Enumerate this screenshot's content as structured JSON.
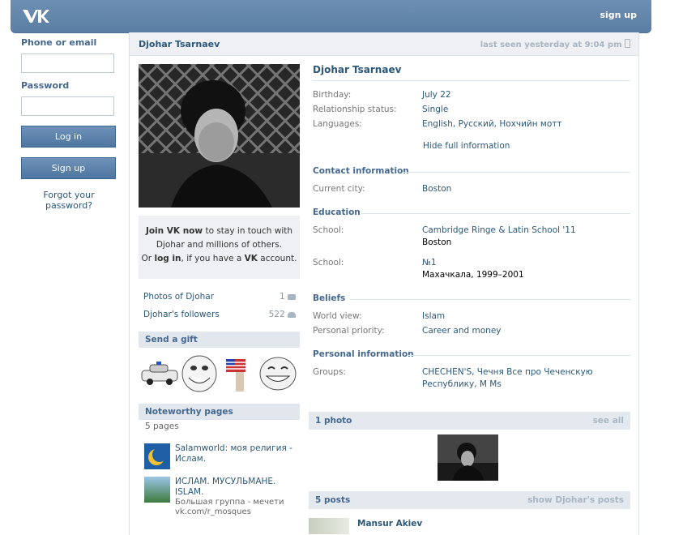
{
  "header": {
    "logo_text": "VK",
    "signup_label": "sign up"
  },
  "login": {
    "phone_label": "Phone or email",
    "password_label": "Password",
    "login_button": "Log in",
    "signup_button": "Sign up",
    "forgot_label": "Forgot your password?"
  },
  "profile": {
    "name": "Djohar Tsarnaev",
    "last_seen": "last seen yesterday at 9:04 pm",
    "join_box": {
      "part1": "Join VK now",
      "part2": " to stay in touch with",
      "line2": "Djohar and millions of others.",
      "line3a": "Or ",
      "line3b": "log in",
      "line3c": ", if you have a ",
      "line3d": "VK",
      "line3e": " account."
    },
    "photos_link": {
      "label": "Photos of Djohar",
      "count": "1"
    },
    "followers_link": {
      "label": "Djohar's followers",
      "count": "522"
    },
    "gift_header": "Send a gift",
    "noteworthy": {
      "header": "Noteworthy pages",
      "count": "5 pages",
      "items": [
        {
          "title": "Salamworld: моя религия - Ислам.",
          "sub": ""
        },
        {
          "title": "ИСЛАМ. МУСУЛЬМАНЕ. ISLAM.",
          "sub": "Большая группа - мечети",
          "sub2": "vk.com/r_mosques"
        }
      ]
    }
  },
  "info": {
    "full_name": "Djohar Tsarnaev",
    "basic": [
      {
        "label": "Birthday:",
        "value": "July 22"
      },
      {
        "label": "Relationship status:",
        "value": "Single"
      },
      {
        "label": "Languages:",
        "value": "English, Русский, Нохчийн мотт"
      }
    ],
    "hide_link": "Hide full information",
    "contact": {
      "title": "Contact information",
      "city_label": "Current city:",
      "city": "Boston"
    },
    "education": {
      "title": "Education",
      "school_label": "School:",
      "school1": "Cambridge Ringe & Latin School '11",
      "school1_city": "Boston",
      "school2": "№1",
      "school2_city": "Махачкала, 1999–2001"
    },
    "beliefs": {
      "title": "Beliefs",
      "world_label": "World view:",
      "world": "Islam",
      "priority_label": "Personal priority:",
      "priority": "Career and money"
    },
    "personal": {
      "title": "Personal information",
      "groups_label": "Groups:",
      "groups_line1": "CHECHEN'S, Чечня Все про Чеченскую",
      "groups_line2": "Республику, M Ms"
    },
    "photos_bar": {
      "title": "1 photo",
      "action": "see all"
    },
    "posts_bar": {
      "title": "5 posts",
      "action": "show Djohar's posts"
    },
    "first_post_author": "Mansur Akiev"
  },
  "colors": {
    "header_blue": "#5b7ea4",
    "link_blue": "#2b587a",
    "section_bar": "#e4e9ef"
  }
}
